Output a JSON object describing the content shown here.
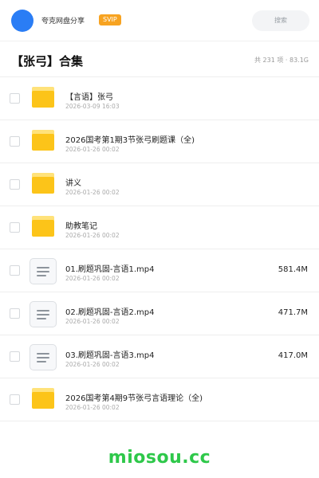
{
  "header": {
    "username": "夸克网盘分享",
    "vip_badge": "SVIP",
    "search_placeholder": "搜索"
  },
  "title_bar": {
    "title": "【张弓】合集",
    "summary": "共 231 项 · 83.1G"
  },
  "files": [
    {
      "type": "folder",
      "name": "【言语】张弓",
      "date": "2026-03-09 16:03",
      "size": ""
    },
    {
      "type": "folder",
      "name": "2026国考第1期3节张弓刷题课（全)",
      "date": "2026-01-26 00:02",
      "size": ""
    },
    {
      "type": "folder",
      "name": "讲义",
      "date": "2026-01-26 00:02",
      "size": ""
    },
    {
      "type": "folder",
      "name": "助教笔记",
      "date": "2026-01-26 00:02",
      "size": ""
    },
    {
      "type": "file",
      "name": "01.刷题巩固-言语1.mp4",
      "date": "2026-01-26 00:02",
      "size": "581.4M"
    },
    {
      "type": "file",
      "name": "02.刷题巩固-言语2.mp4",
      "date": "2026-01-26 00:02",
      "size": "471.7M"
    },
    {
      "type": "file",
      "name": "03.刷题巩固-言语3.mp4",
      "date": "2026-01-26 00:02",
      "size": "417.0M"
    },
    {
      "type": "folder",
      "name": "2026国考第4期9节张弓言语理论（全)",
      "date": "2026-01-26 00:02",
      "size": ""
    }
  ],
  "watermark": "miosou.cc"
}
